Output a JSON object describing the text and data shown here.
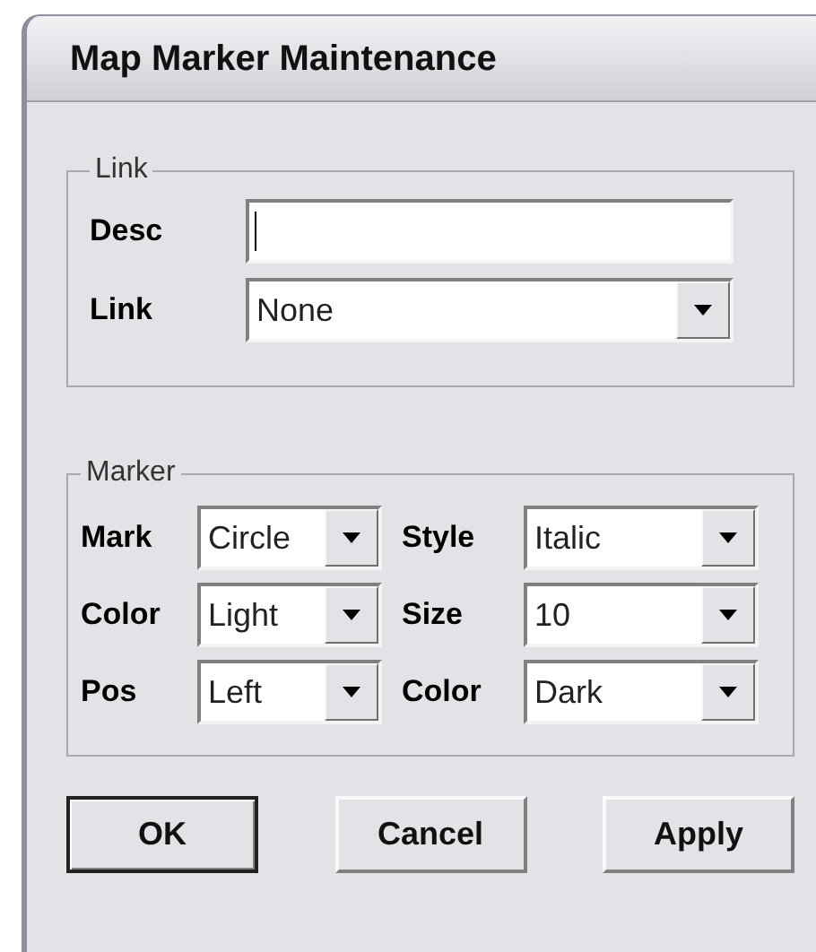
{
  "window": {
    "title": "Map Marker Maintenance"
  },
  "link_group": {
    "legend": "Link",
    "desc": {
      "label": "Desc",
      "focused": true
    },
    "link": {
      "label": "Link",
      "value": "None"
    }
  },
  "marker_group": {
    "legend": "Marker",
    "fields": [
      {
        "label": "Mark",
        "value": "Circle"
      },
      {
        "label": "Style",
        "value": "Italic"
      },
      {
        "label": "Color",
        "value": "Light"
      },
      {
        "label": "Size",
        "value": "10"
      },
      {
        "label": "Pos",
        "value": "Left"
      },
      {
        "label": "Color",
        "value": "Dark"
      }
    ]
  },
  "buttons": [
    {
      "label": "OK",
      "default": true
    },
    {
      "label": "Cancel",
      "default": false
    },
    {
      "label": "Apply",
      "default": false
    }
  ]
}
